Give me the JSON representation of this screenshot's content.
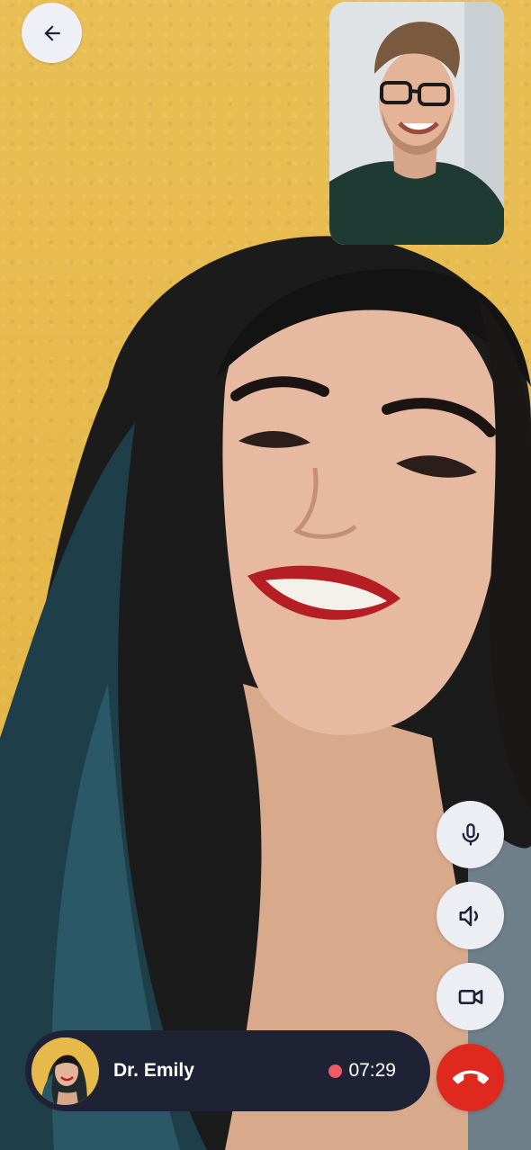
{
  "call": {
    "caller_name": "Dr. Emily",
    "duration": "07:29",
    "recording_indicator_color": "#f05a66"
  },
  "icons": {
    "back": "arrow-left-icon",
    "mic": "microphone-icon",
    "speaker": "speaker-icon",
    "video": "video-camera-icon",
    "end_call": "phone-hangup-icon"
  },
  "colors": {
    "bar_background": "#1f2235",
    "control_background": "#eceef4",
    "end_call": "#e0291e",
    "wall": "#e7b94b"
  }
}
